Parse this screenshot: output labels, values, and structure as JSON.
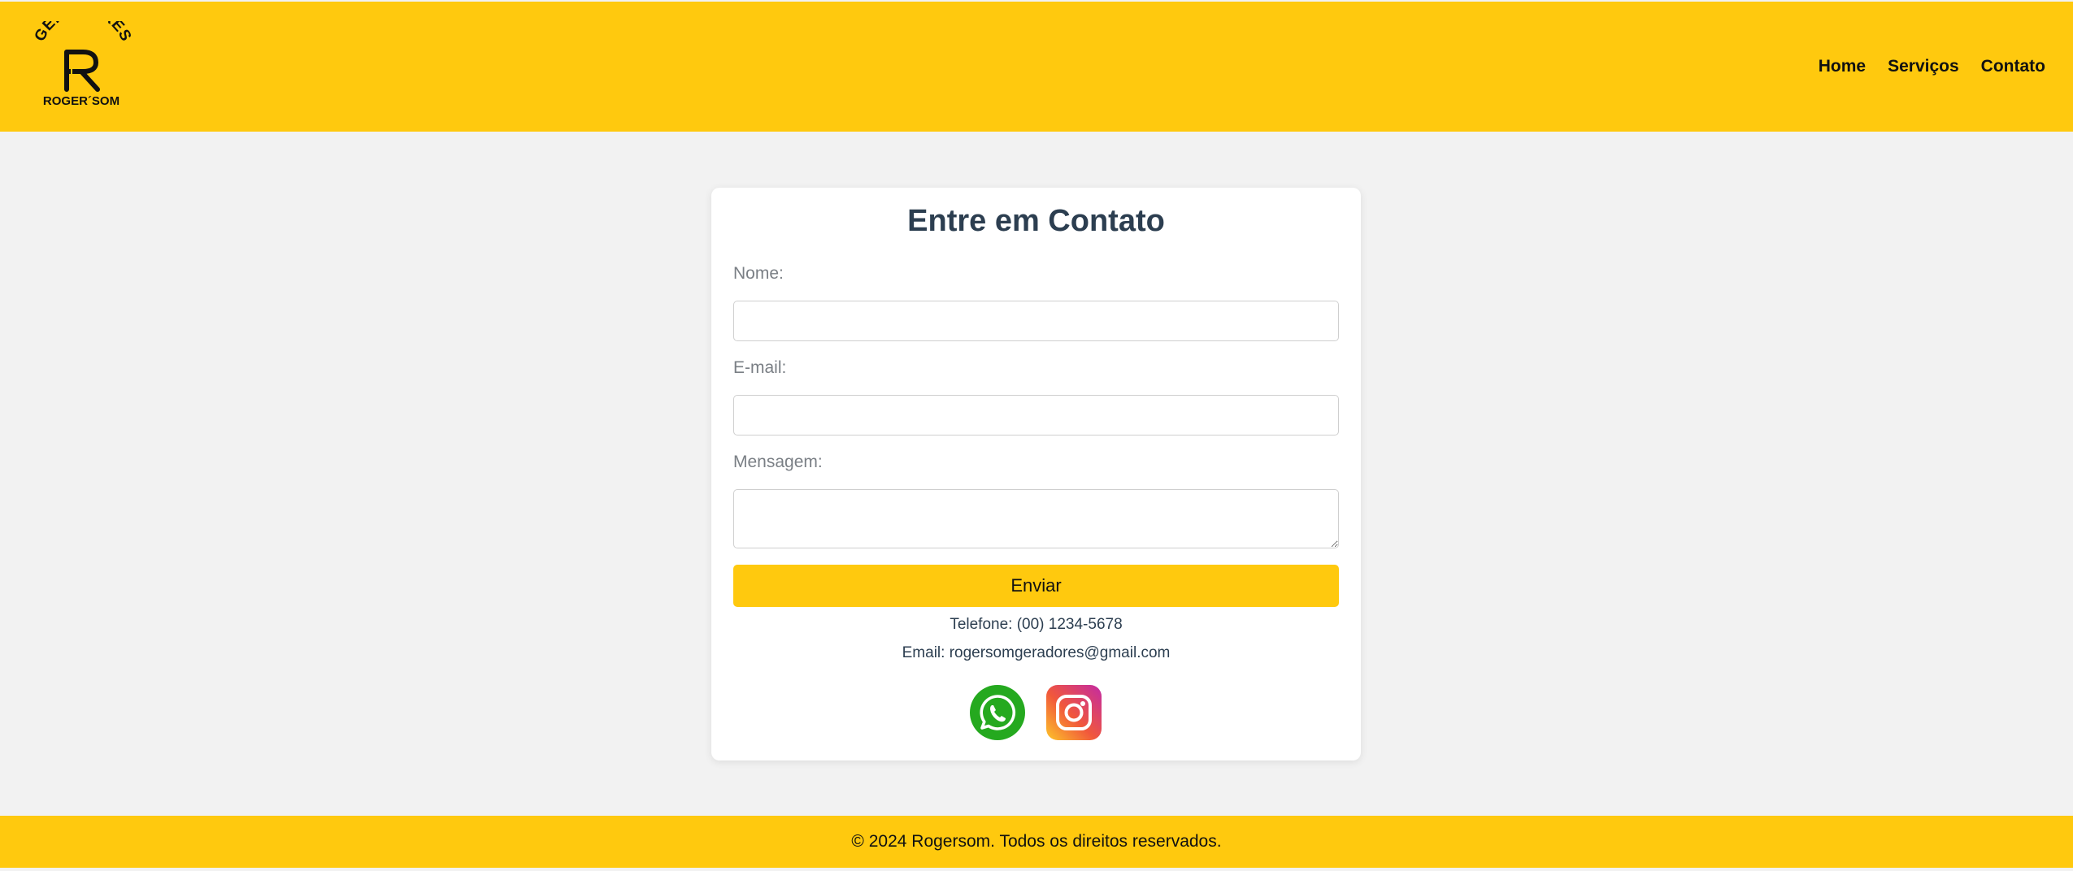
{
  "header": {
    "logo_text_top": "GERADORES",
    "logo_text_bottom": "ROGER´SOM",
    "nav": [
      {
        "label": "Home"
      },
      {
        "label": "Serviços"
      },
      {
        "label": "Contato"
      }
    ]
  },
  "contact": {
    "title": "Entre em Contato",
    "name_label": "Nome:",
    "name_value": "",
    "email_label": "E-mail:",
    "email_value": "",
    "message_label": "Mensagem:",
    "message_value": "",
    "submit_label": "Enviar",
    "phone": "Telefone: (00) 1234-5678",
    "email": "Email: rogersomgeradores@gmail.com",
    "social": [
      {
        "icon": "whatsapp-icon",
        "color": "#25a91f"
      },
      {
        "icon": "instagram-icon",
        "color": "#d6249f"
      }
    ]
  },
  "footer": {
    "text": "© 2024 Rogersom. Todos os direitos reservados."
  },
  "colors": {
    "accent": "#ffc90e",
    "background": "#f2f2f2",
    "title": "#2c3e50"
  }
}
